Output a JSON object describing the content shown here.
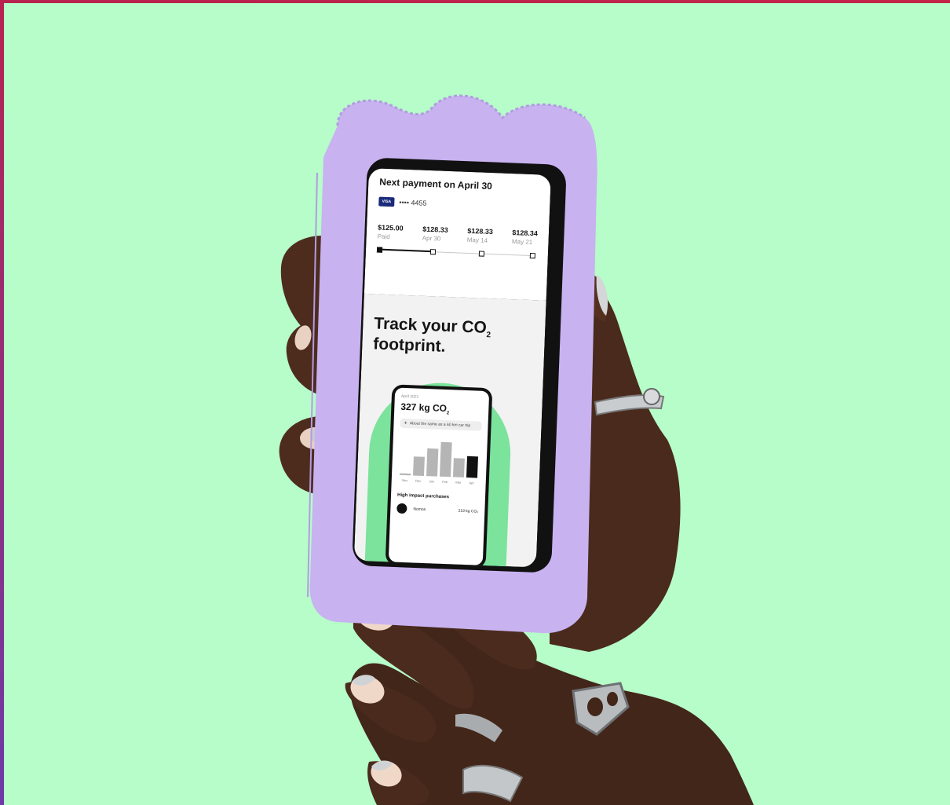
{
  "colors": {
    "background": "#b6fdc9",
    "case": "#c8b2f0",
    "skin": "#4a2a1c",
    "arch": "#7be39b"
  },
  "app": {
    "title": "Next payment on April 30",
    "card_brand": "VISA",
    "card_number": "•••• 4455",
    "payments": [
      {
        "amount": "$125.00",
        "label": "Paid"
      },
      {
        "amount": "$128.33",
        "label": "Apr 30"
      },
      {
        "amount": "$128.33",
        "label": "May 14"
      },
      {
        "amount": "$128.34",
        "label": "May 21"
      }
    ],
    "headline_line1": "Track your CO",
    "headline_sub": "2",
    "headline_line2": "footprint.",
    "inner": {
      "date": "April 2021",
      "amount": "327 kg CO",
      "amount_sub": "2",
      "comparison": "About the same as a 60 km car trip",
      "months": [
        "Nov",
        "Dec",
        "Jan",
        "Feb",
        "Mar",
        "Apr"
      ],
      "values": [
        0.05,
        0.55,
        0.8,
        1.0,
        0.55,
        0.62
      ],
      "section": "High impact purchases",
      "purchase_name": "Nomos",
      "purchase_value": "219 kg CO₂"
    }
  }
}
